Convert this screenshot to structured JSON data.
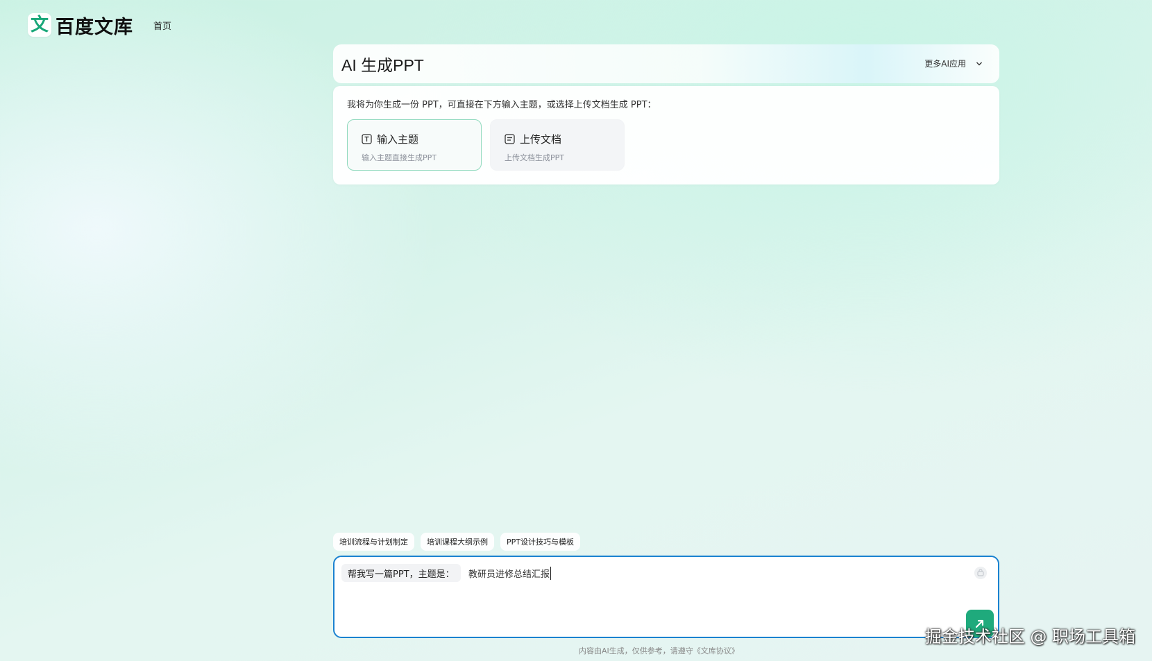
{
  "brand": {
    "logo_glyph": "文",
    "name": "百度文库"
  },
  "nav": {
    "home": "首页"
  },
  "header": {
    "title": "AI 生成PPT",
    "more_apps": "更多AI应用"
  },
  "mode_card": {
    "intro": "我将为你生成一份 PPT，可直接在下方输入主题，或选择上传文档生成 PPT：",
    "options": [
      {
        "title": "输入主题",
        "subtitle": "输入主题直接生成PPT",
        "icon": "text-icon",
        "selected": true
      },
      {
        "title": "上传文档",
        "subtitle": "上传文档生成PPT",
        "icon": "document-icon",
        "selected": false
      }
    ]
  },
  "suggestions": [
    "培训流程与计划制定",
    "培训课程大纲示例",
    "PPT设计技巧与模板"
  ],
  "input": {
    "prefix": "帮我写一篇PPT，主题是：",
    "value": "教研员进修总结汇报"
  },
  "footer": {
    "note": "内容由AI生成，仅供参考，请遵守《文库协议》"
  },
  "watermark": "掘金技术社区 @ 职场工具箱",
  "colors": {
    "accent": "#1faa7c",
    "input_border": "#1a82d0",
    "selected_border": "#8fd9bd"
  }
}
